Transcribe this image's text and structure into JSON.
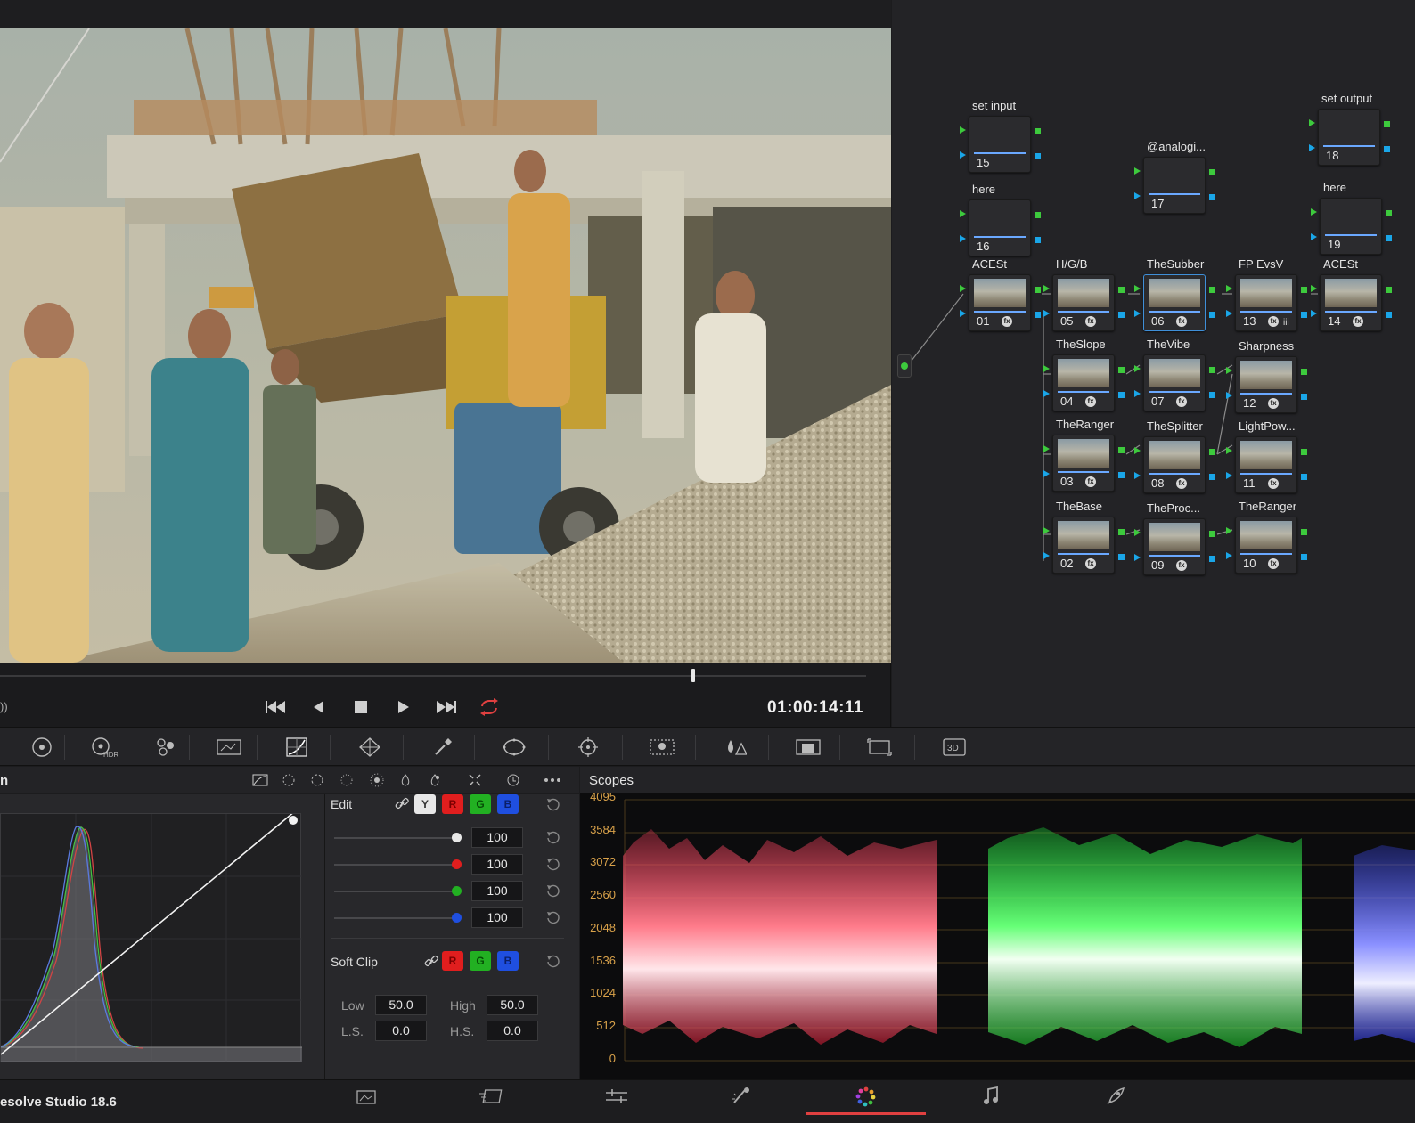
{
  "viewer": {
    "timecode": "01:00:14:11",
    "volume_mark": "))",
    "playhead_fraction": 0.79
  },
  "transport": {
    "buttons": [
      "go-to-start",
      "play-reverse",
      "stop",
      "play",
      "go-to-end",
      "loop"
    ]
  },
  "nodes": [
    {
      "label": "set input",
      "num": "15"
    },
    {
      "label": "here",
      "num": "16"
    },
    {
      "label": "@analogi...",
      "num": "17"
    },
    {
      "label": "set output",
      "num": "18"
    },
    {
      "label": "here",
      "num": "19"
    },
    {
      "label": "ACESt",
      "num": "01"
    },
    {
      "label": "H/G/B",
      "num": "05"
    },
    {
      "label": "TheSubber",
      "num": "06"
    },
    {
      "label": "FP EvsV",
      "num": "13"
    },
    {
      "label": "ACESt",
      "num": "14"
    },
    {
      "label": "TheSlope",
      "num": "04"
    },
    {
      "label": "TheVibe",
      "num": "07"
    },
    {
      "label": "Sharpness",
      "num": "12"
    },
    {
      "label": "TheRanger",
      "num": "03"
    },
    {
      "label": "TheSplitter",
      "num": "08"
    },
    {
      "label": "LightPow...",
      "num": "11"
    },
    {
      "label": "TheBase",
      "num": "02"
    },
    {
      "label": "TheProc...",
      "num": "09"
    },
    {
      "label": "TheRanger",
      "num": "10"
    }
  ],
  "palette_toolbar": {
    "items": [
      "camera-raw-icon",
      "color-wheels-icon",
      "hdr-icon",
      "rgb-mixer-icon",
      "motion-effects-icon",
      "curves-icon",
      "color-warper-icon",
      "qualifier-icon",
      "window-icon",
      "tracker-icon",
      "magic-mask-icon",
      "blur-icon",
      "key-icon",
      "sizing-icon",
      "3d-icon"
    ],
    "hdr_label": "HDR",
    "3d_label": "3D"
  },
  "curves": {
    "title": "n",
    "edit_label": "Edit",
    "channels": [
      "Y",
      "R",
      "G",
      "B"
    ],
    "intensity": [
      "100",
      "100",
      "100",
      "100"
    ],
    "soft_clip_label": "Soft Clip",
    "soft_clip_channels": [
      "R",
      "G",
      "B"
    ],
    "low_label": "Low",
    "low_value": "50.0",
    "high_label": "High",
    "high_value": "50.0",
    "ls_label": "L.S.",
    "ls_value": "0.0",
    "hs_label": "H.S.",
    "hs_value": "0.0"
  },
  "scopes": {
    "title": "Scopes",
    "y_ticks": [
      "4095",
      "3584",
      "3072",
      "2560",
      "2048",
      "1536",
      "1024",
      "512",
      "0"
    ]
  },
  "pagebar": {
    "app_name": "esolve Studio 18.6",
    "pages": [
      "media-page-icon",
      "cut-page-icon",
      "edit-page-icon",
      "fusion-page-icon",
      "color-page-icon",
      "fairlight-page-icon",
      "deliver-page-icon"
    ],
    "active_page": "color-page-icon"
  },
  "colors": {
    "accent_red": "#e04040",
    "node_green": "#3dca3d",
    "node_blue": "#1aa6e8",
    "scope_tick": "#d9a24a"
  }
}
